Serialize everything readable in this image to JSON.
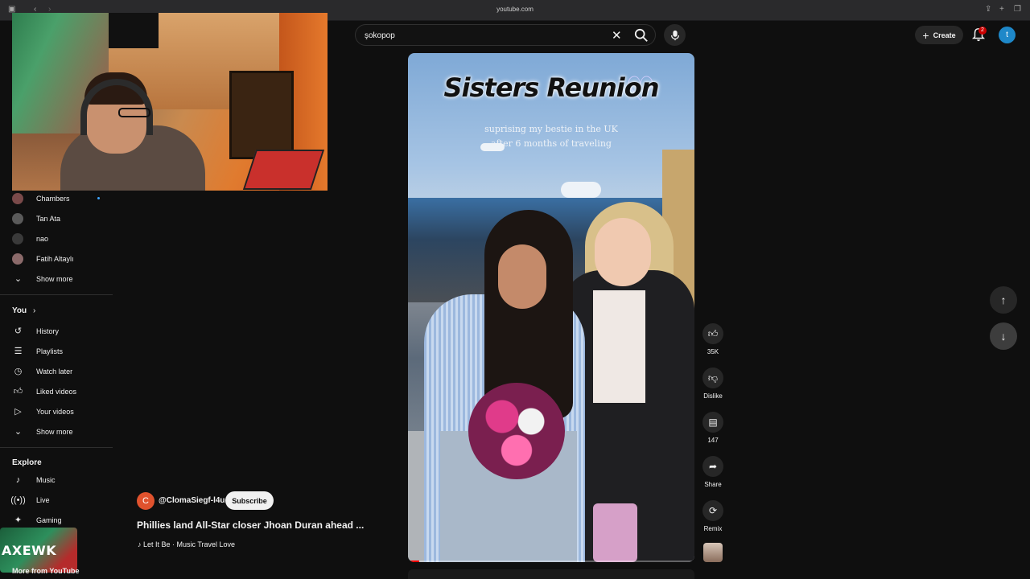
{
  "browser": {
    "url": "youtube.com"
  },
  "search": {
    "value": "şokopop"
  },
  "header": {
    "create_label": "Create",
    "notification_count": "2",
    "user_initial": "t"
  },
  "sidebar": {
    "subscriptions": [
      {
        "label": "Chambers",
        "color": "#7a4a4a"
      },
      {
        "label": "Tan Ata",
        "color": "#5a5a5a"
      },
      {
        "label": "nao",
        "color": "#3a3a3a"
      },
      {
        "label": "Fatih Altaylı",
        "color": "#8b6a6a"
      }
    ],
    "subs_show_more": "Show more",
    "you_heading": "You",
    "you_items": [
      {
        "label": "History",
        "icon": "history-icon"
      },
      {
        "label": "Playlists",
        "icon": "playlists-icon"
      },
      {
        "label": "Watch later",
        "icon": "clock-icon"
      },
      {
        "label": "Liked videos",
        "icon": "thumbs-up-icon"
      },
      {
        "label": "Your videos",
        "icon": "play-square-icon"
      }
    ],
    "you_show_more": "Show more",
    "explore_heading": "Explore",
    "explore_items": [
      {
        "label": "Music",
        "icon": "music-note-icon"
      },
      {
        "label": "Live",
        "icon": "live-icon"
      },
      {
        "label": "Gaming",
        "icon": "gaming-icon"
      }
    ],
    "more_from": "More from YouTube"
  },
  "overlay_logo": "AXEWK",
  "short": {
    "title": "Sisters Reunion",
    "subtitle_line1": "suprising my bestie in the UK",
    "subtitle_line2": "after 6 months of traveling",
    "progress": 0.04
  },
  "meta": {
    "channel_initial": "C",
    "channel": "@ClomaSiegf-l4u",
    "subscribe_label": "Subscribe",
    "video_title": "Phillies land All-Star closer Jhoan Duran ahead ...",
    "music": "Let It Be · Music Travel Love"
  },
  "actions": {
    "like_count": "35K",
    "dislike_label": "Dislike",
    "comment_count": "147",
    "share_label": "Share",
    "remix_label": "Remix"
  }
}
